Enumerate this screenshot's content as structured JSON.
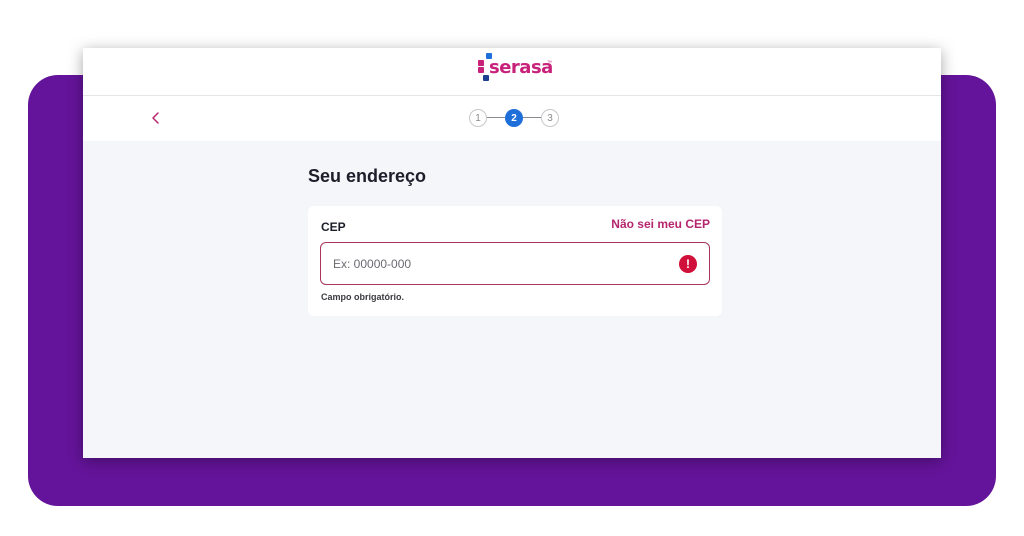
{
  "brand": {
    "logo_text": "serasa",
    "logo_tm": "™",
    "colors": {
      "magenta": "#c8217a",
      "blue": "#1e6fd9",
      "navy": "#1c3f8f",
      "purple_background": "#64149a",
      "error_red": "#d0103a"
    }
  },
  "nav": {
    "back_icon": "chevron-left-icon"
  },
  "stepper": {
    "steps": [
      {
        "label": "1",
        "state": "inactive"
      },
      {
        "label": "2",
        "state": "active"
      },
      {
        "label": "3",
        "state": "inactive"
      }
    ]
  },
  "main": {
    "title": "Seu endereço",
    "cep": {
      "label": "CEP",
      "link": "Não sei meu CEP",
      "value": "",
      "placeholder": "Ex: 00000-000",
      "error_icon": "exclamation-icon",
      "error_symbol": "!",
      "helper": "Campo obrigatório."
    }
  }
}
